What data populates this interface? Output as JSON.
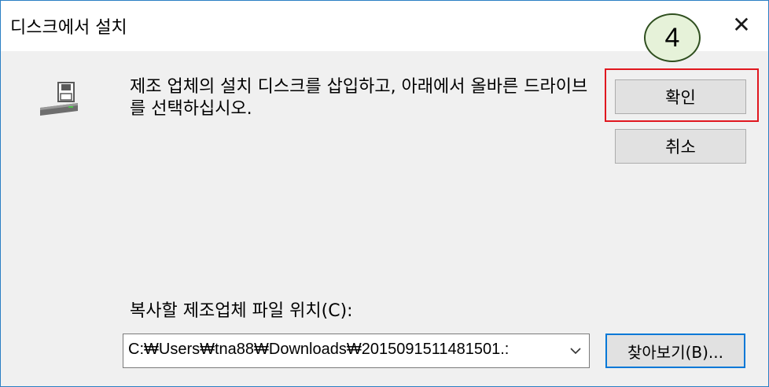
{
  "dialog": {
    "title": "디스크에서 설치",
    "close_glyph": "✕",
    "message": "제조 업체의 설치 디스크를 삽입하고, 아래에서 올바른 드라이브를 선택하십시오.",
    "icon": "floppy-drive-icon"
  },
  "annotation": {
    "step_number": "4",
    "highlight_color": "#e0171f"
  },
  "buttons": {
    "ok_label": "확인",
    "cancel_label": "취소",
    "browse_label": "찾아보기(B)..."
  },
  "path": {
    "label": "복사할 제조업체 파일 위치(C):",
    "value": "C:₩Users₩tna88₩Downloads₩2015091511481501.:"
  },
  "colors": {
    "window_border": "#2b7fc4",
    "focus_accent": "#0078d7"
  }
}
